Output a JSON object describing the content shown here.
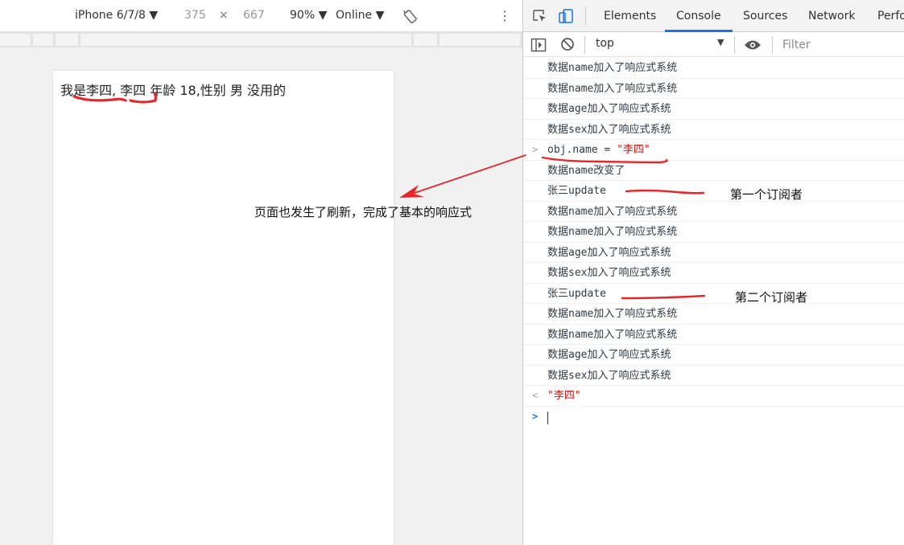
{
  "device_toolbar": {
    "model": "iPhone 6/7/8 ▼",
    "width": "375",
    "times": "×",
    "height": "667",
    "zoom": "90% ▼",
    "throttle": "Online ▼",
    "more": "⋮"
  },
  "page": {
    "text": "我是李四, 李四 年龄 18,性别 男 没用的"
  },
  "annotation": {
    "main": "页面也发生了刷新，完成了基本的响应式",
    "first_subscriber": "第一个订阅者",
    "second_subscriber": "第二个订阅者"
  },
  "devtools": {
    "tabs": [
      "Elements",
      "Console",
      "Sources",
      "Network",
      "Perfo"
    ],
    "active_tab": "Console",
    "console_context": "top",
    "filter_placeholder": "Filter",
    "log": [
      {
        "text": "数据name加入了响应式系统"
      },
      {
        "text": "数据name加入了响应式系统"
      },
      {
        "text": "数据age加入了响应式系统"
      },
      {
        "text": "数据sex加入了响应式系统"
      },
      {
        "input_prefix": "obj.name = ",
        "input_string": "\"李四\""
      },
      {
        "text": "数据name改变了"
      },
      {
        "text": "张三update"
      },
      {
        "text": "数据name加入了响应式系统"
      },
      {
        "text": "数据name加入了响应式系统"
      },
      {
        "text": "数据age加入了响应式系统"
      },
      {
        "text": "数据sex加入了响应式系统"
      },
      {
        "text": "张三update"
      },
      {
        "text": "数据name加入了响应式系统"
      },
      {
        "text": "数据name加入了响应式系统"
      },
      {
        "text": "数据age加入了响应式系统"
      },
      {
        "text": "数据sex加入了响应式系统"
      },
      {
        "result": "\"李四\""
      }
    ]
  },
  "colors": {
    "accent": "#1a73e8",
    "string_value": "#c41a16",
    "annotation_red": "#e8262a"
  }
}
